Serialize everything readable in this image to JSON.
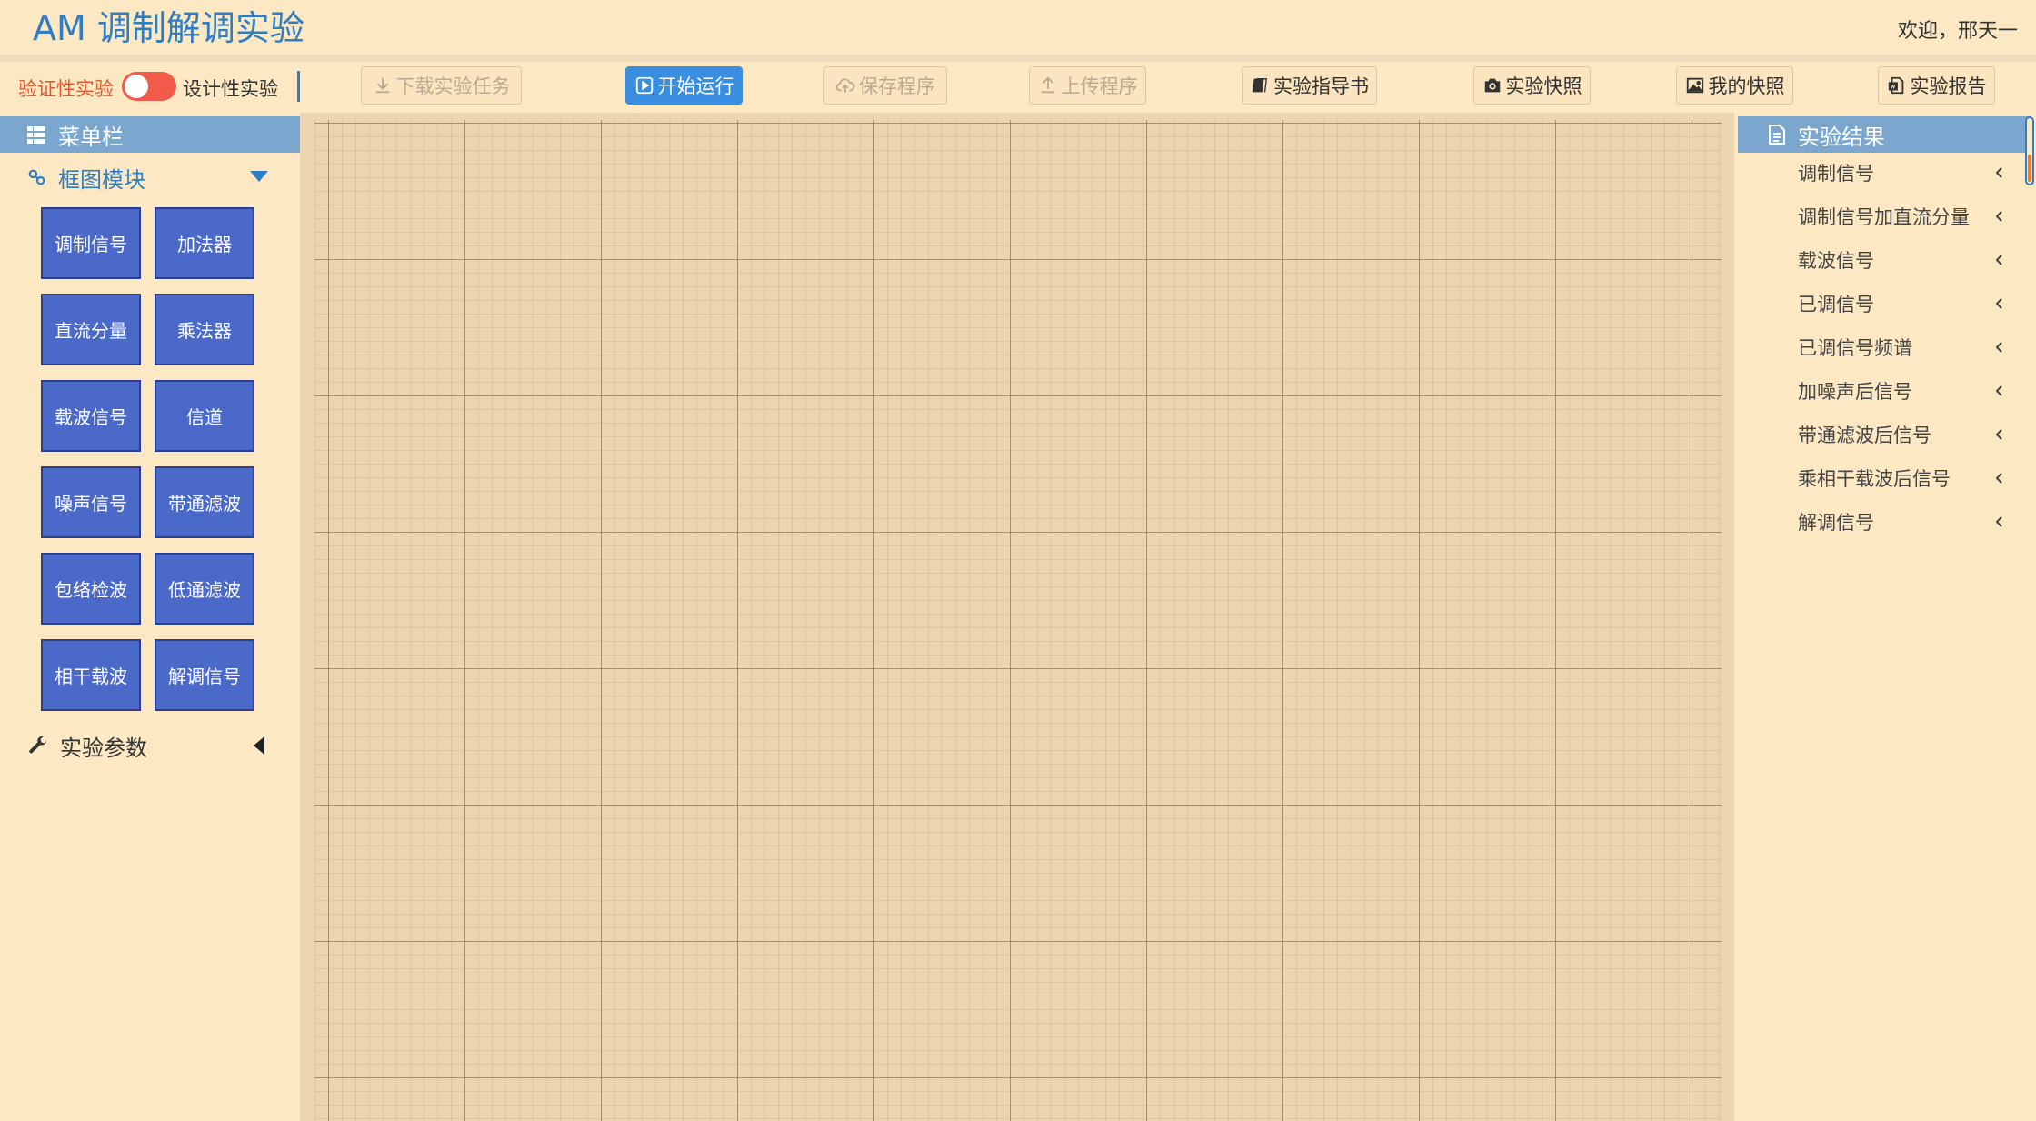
{
  "header": {
    "title": "AM 调制解调实验",
    "welcome": "欢迎，邢天一"
  },
  "toolbar": {
    "mode_left": "验证性实验",
    "mode_right": "设计性实验",
    "buttons": [
      {
        "label": "下载实验任务",
        "icon": "download-icon",
        "state": "disabled"
      },
      {
        "label": "开始运行",
        "icon": "play-icon",
        "state": "primary"
      },
      {
        "label": "保存程序",
        "icon": "cloud-upload-icon",
        "state": "disabled"
      },
      {
        "label": "上传程序",
        "icon": "upload-icon",
        "state": "disabled"
      },
      {
        "label": "实验指导书",
        "icon": "book-icon",
        "state": "normal"
      },
      {
        "label": "实验快照",
        "icon": "camera-icon",
        "state": "normal"
      },
      {
        "label": "我的快照",
        "icon": "image-icon",
        "state": "normal"
      },
      {
        "label": "实验报告",
        "icon": "word-file-icon",
        "state": "normal"
      }
    ]
  },
  "sidebar": {
    "menu_title": "菜单栏",
    "module_section": "框图模块",
    "modules": [
      "调制信号",
      "加法器",
      "直流分量",
      "乘法器",
      "载波信号",
      "信道",
      "噪声信号",
      "带通滤波",
      "包络检波",
      "低通滤波",
      "相干载波",
      "解调信号"
    ],
    "params_section": "实验参数"
  },
  "results": {
    "title": "实验结果",
    "items": [
      "调制信号",
      "调制信号加直流分量",
      "载波信号",
      "已调信号",
      "已调信号频谱",
      "加噪声后信号",
      "带通滤波后信号",
      "乘相干载波后信号",
      "解调信号"
    ]
  },
  "colors": {
    "background": "#fde8c4",
    "accent": "#2f7ec4",
    "primary_button": "#3a8ee0",
    "module_button": "#4a69c9",
    "panel_header": "#7ba7cf",
    "toggle": "#f25a4a"
  }
}
